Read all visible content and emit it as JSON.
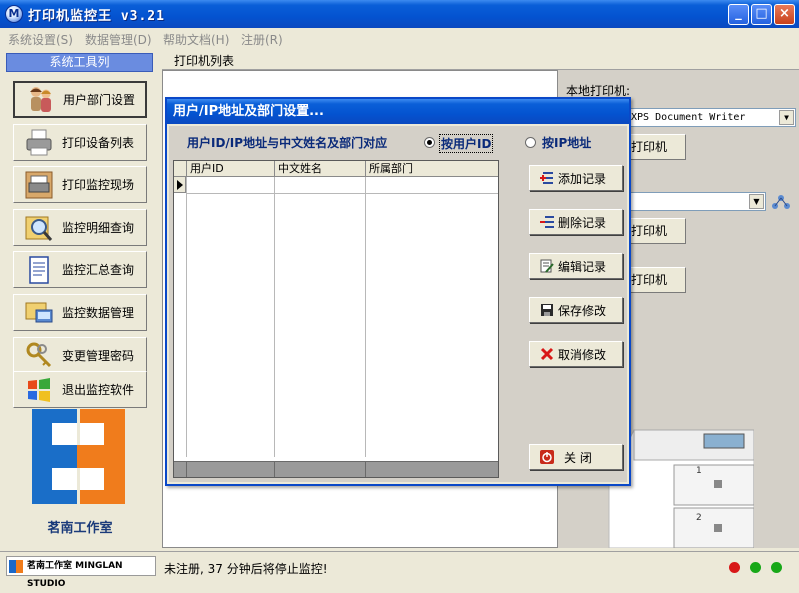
{
  "app": {
    "title": "打印机监控王 v3.21",
    "icon_letter": "M"
  },
  "window_controls": {
    "minimize": "_",
    "maximize": "□",
    "close": "×"
  },
  "menu": [
    "系统设置(S)",
    "数据管理(D)",
    "帮助文档(H)",
    "注册(R)"
  ],
  "sidebar": {
    "header": "系统工具列",
    "items": [
      {
        "label": "用户部门设置",
        "icon": "users-icon"
      },
      {
        "label": "打印设备列表",
        "icon": "printer-icon"
      },
      {
        "label": "打印监控现场",
        "icon": "print-monitor-icon"
      },
      {
        "label": "监控明细查询",
        "icon": "magnifier-icon"
      },
      {
        "label": "监控汇总查询",
        "icon": "document-icon"
      },
      {
        "label": "监控数据管理",
        "icon": "data-manage-icon"
      },
      {
        "label": "变更管理密码",
        "icon": "keys-icon"
      },
      {
        "label": "退出监控软件",
        "icon": "windows-icon"
      }
    ],
    "logo_text": "茗南工作室"
  },
  "tab": {
    "label": "打印机列表"
  },
  "right_pane": {
    "label": "本地打印机:",
    "combo_value": "XPS Document Writer",
    "button1": "打印机",
    "button2": "打印机",
    "button3": "打印机"
  },
  "dialog": {
    "title": "用户/IP地址及部门设置...",
    "caption": "用户ID/IP地址与中文姓名及部门对应",
    "radio_user": "按用户ID",
    "radio_ip": "按IP地址",
    "selected": "user",
    "columns": [
      "用户ID",
      "中文姓名",
      "所属部门"
    ],
    "buttons": {
      "add": "添加记录",
      "delete": "删除记录",
      "edit": "编辑记录",
      "save": "保存修改",
      "cancel": "取消修改",
      "close": "关  闭"
    }
  },
  "status": {
    "brand": "茗南工作室 MINGLAN STUDIO",
    "message": "未注册, 37 分钟后将停止监控!",
    "lights": [
      "#d81818",
      "#18a818",
      "#18a818"
    ]
  }
}
